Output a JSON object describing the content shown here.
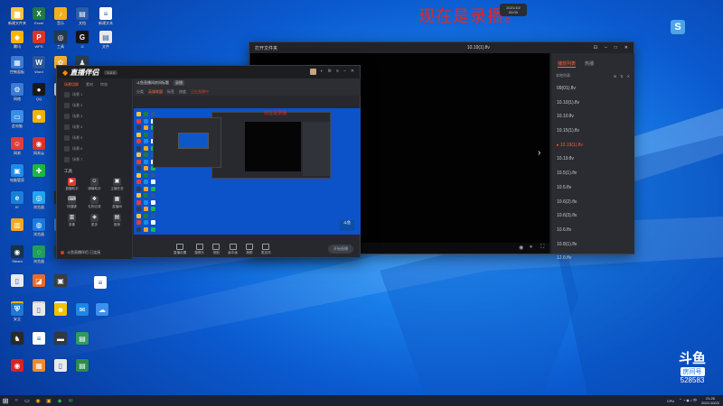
{
  "desktop": {
    "icons": [
      {
        "label": "新建文件夹",
        "color": "#f4c542",
        "glyph": "▆"
      },
      {
        "label": "Excel",
        "color": "#1f7a44",
        "glyph": "X"
      },
      {
        "label": "音乐",
        "color": "#f2b01e",
        "glyph": "♪"
      },
      {
        "label": "文档",
        "color": "#2b5caa",
        "glyph": "▤"
      },
      {
        "label": "新建文本",
        "color": "#ffffff",
        "glyph": "≡"
      },
      {
        "label": "腾讯",
        "color": "#ffb400",
        "glyph": "◆"
      },
      {
        "label": "WPS",
        "color": "#d9352a",
        "glyph": "P"
      },
      {
        "label": "工具",
        "color": "#27374d",
        "glyph": "◎"
      },
      {
        "label": "G",
        "color": "#151515",
        "glyph": "G"
      },
      {
        "label": "文件",
        "color": "#eaeaea",
        "glyph": "▤"
      },
      {
        "label": "控制面板",
        "color": "#3a7bd5",
        "glyph": "▦"
      },
      {
        "label": "Word",
        "color": "#2b579a",
        "glyph": "W"
      },
      {
        "label": "斗鱼",
        "color": "#f9b234",
        "glyph": "✿"
      },
      {
        "label": "",
        "color": "#2c3e50",
        "glyph": "♟"
      },
      {
        "label": "网络",
        "color": "#3a7bd5",
        "glyph": "⚙"
      },
      {
        "label": "QQ",
        "color": "#1a1a1a",
        "glyph": "●"
      },
      {
        "label": "",
        "color": "#e8f0ff",
        "glyph": "◔"
      },
      {
        "label": "此电脑",
        "color": "#3a8ee6",
        "glyph": "▭"
      },
      {
        "label": "",
        "color": "#f5b400",
        "glyph": "☻"
      },
      {
        "label": "网易",
        "color": "#e23c3c",
        "glyph": "☺"
      },
      {
        "label": "网易云",
        "color": "#e03131",
        "glyph": "◉"
      },
      {
        "label": "电脑管家",
        "color": "#1a8ceb",
        "glyph": "▣"
      },
      {
        "label": "",
        "color": "#1fb845",
        "glyph": "✚"
      },
      {
        "label": "IE",
        "color": "#1b7fd8",
        "glyph": "e"
      },
      {
        "label": "浏览器",
        "color": "#23a6f0",
        "glyph": "◎"
      },
      {
        "label": "",
        "color": "#2a2f36",
        "glyph": "▬"
      },
      {
        "label": "",
        "color": "#f2a623",
        "glyph": "▥"
      },
      {
        "label": "浏览器",
        "color": "#1d7ce2",
        "glyph": "◍"
      },
      {
        "label": "",
        "color": "#2d8ae6",
        "glyph": "✎"
      },
      {
        "label": "Steam",
        "color": "#18324a",
        "glyph": "◉"
      },
      {
        "label": "浏览器",
        "color": "#1fa15b",
        "glyph": "◌"
      },
      {
        "label": "",
        "color": "#2b3b4f",
        "glyph": "▤"
      },
      {
        "label": "",
        "color": "#e8eaee",
        "glyph": "▯"
      },
      {
        "label": "",
        "color": "#ec6a2a",
        "glyph": "◪"
      },
      {
        "label": "",
        "color": "#3d3d3d",
        "glyph": "▣"
      },
      {
        "label": "",
        "color": "#f6b600",
        "glyph": "▦"
      },
      {
        "label": "",
        "color": "#d9d9d9",
        "glyph": "▯"
      },
      {
        "label": "",
        "color": "#ffffff",
        "glyph": "◎"
      },
      {
        "label": "",
        "color": "#ffffff",
        "glyph": "≡"
      },
      {
        "label": "安全",
        "color": "#1d78d8",
        "glyph": "⛨"
      },
      {
        "label": "",
        "color": "#e8e8e8",
        "glyph": "▯"
      },
      {
        "label": "",
        "color": "#f2c200",
        "glyph": "☻"
      },
      {
        "label": "",
        "color": "#1e86e4",
        "glyph": "✉"
      },
      {
        "label": "",
        "color": "#3d8ff0",
        "glyph": "☁"
      },
      {
        "label": "",
        "color": "#2a2a2a",
        "glyph": "♞"
      },
      {
        "label": "",
        "color": "#ffffff",
        "glyph": "≡"
      },
      {
        "label": "",
        "color": "#333940",
        "glyph": "▬"
      },
      {
        "label": "",
        "color": "#2e9b63",
        "glyph": "▤"
      },
      {
        "label": "",
        "color": "#d92323",
        "glyph": "◉"
      },
      {
        "label": "",
        "color": "#ec8a2a",
        "glyph": "▦"
      },
      {
        "label": "",
        "color": "#eaeaea",
        "glyph": "▯"
      },
      {
        "label": "",
        "color": "#2c8c4e",
        "glyph": "▤"
      }
    ]
  },
  "banner": {
    "recording_text": "现在是录播。",
    "pill_line1": "2021/10/",
    "pill_line2": "00:00"
  },
  "player": {
    "title_left": "打开文件夹",
    "title_center": "10.19(1).flv",
    "tabs": [
      "播放列表",
      "热播"
    ],
    "tools_label": "本地列表",
    "playlist": [
      "09(01).flv",
      "10.10(1).flv",
      "10.10.flv",
      "10.15(1).flv",
      "10.19(1).flv",
      "10.19.flv",
      "10.5(1).flv",
      "10.5.flv",
      "10.6(2).flv",
      "10.6(3).flv",
      "10.6.flv",
      "10.8(1).flv",
      "12.8.flv"
    ],
    "current_index": 4
  },
  "live": {
    "logo_a": "直播伴侣",
    "version": "5.0.0",
    "left_tabs": [
      "场景切换",
      "素材",
      "特效"
    ],
    "scenes": [
      "场景 1",
      "场景 2",
      "场景 3",
      "场景 4",
      "场景 5",
      "场景 6",
      "场景 7"
    ],
    "tools_title": "工具",
    "tools": [
      {
        "label": "直播助手",
        "icon": "▶",
        "red": true
      },
      {
        "label": "弹幕助手",
        "icon": "☺",
        "red": false
      },
      {
        "label": "主播任务",
        "icon": "▣",
        "red": false
      },
      {
        "label": "快捷键",
        "icon": "⌨",
        "red": false
      },
      {
        "label": "礼物记录",
        "icon": "❖",
        "red": false
      },
      {
        "label": "直播间",
        "icon": "▦",
        "red": false
      },
      {
        "label": "录像",
        "icon": "▥",
        "red": false
      },
      {
        "label": "更多",
        "icon": "◈",
        "red": false
      },
      {
        "label": "推荐",
        "icon": "▤",
        "red": false
      }
    ],
    "status_text": "斗鱼直播伴侣 已连接",
    "room_title": "斗鱼直播间房间标题",
    "room_tag": "录播",
    "room_row2": [
      "分类",
      "英雄联盟",
      "标签",
      "热度",
      "正在直播中"
    ],
    "preview_rec_text": "现在是录播",
    "bottom_tools": [
      "直播设置",
      "摄像头",
      "录制",
      "画中画",
      "美颜",
      "麦克风"
    ],
    "start_button": "开始直播",
    "brand": "斗鱼"
  },
  "watermark": {
    "logo": "斗鱼",
    "room_label": "房间号",
    "room_number": "528583"
  },
  "taskbar": {
    "items": [
      {
        "glyph": "◉",
        "color": "#ffb100"
      },
      {
        "glyph": "▣",
        "color": "#f0b429"
      },
      {
        "glyph": "◆",
        "color": "#2bb24c"
      },
      {
        "glyph": "✉",
        "color": "#2bb24c"
      }
    ],
    "tray_text": "CPU",
    "time": "21:26",
    "date": "2021/10/22"
  }
}
